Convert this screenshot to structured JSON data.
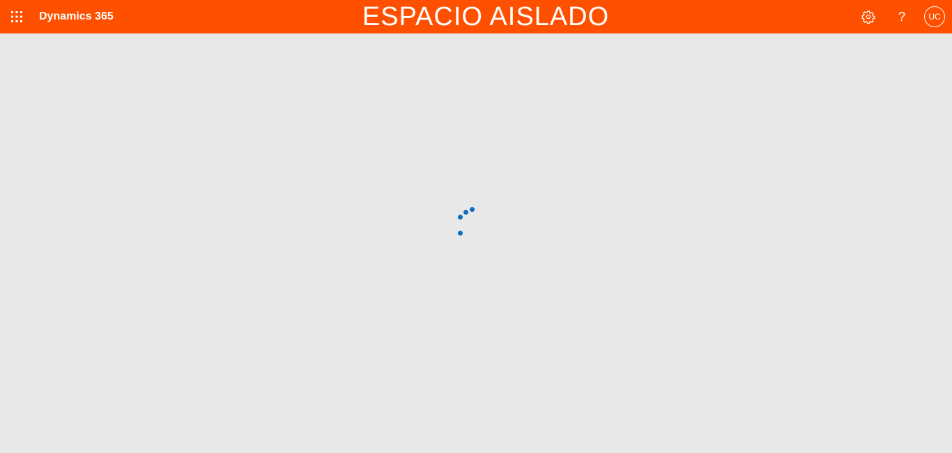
{
  "header": {
    "app_name": "Dynamics 365",
    "environment_title": "ESPACIO AISLADO",
    "user_initials": "UC",
    "background_color": "#ff5000",
    "icons": {
      "app_launcher": "waffle-icon",
      "settings": "gear-icon",
      "help": "help-icon"
    },
    "help_glyph": "?"
  },
  "main": {
    "state": "loading",
    "spinner_color": "#0f6cbd",
    "background_color": "#e8e8e8"
  }
}
